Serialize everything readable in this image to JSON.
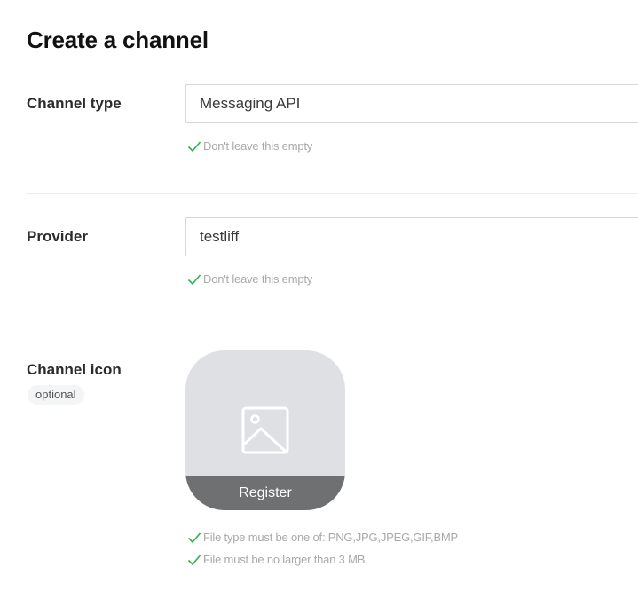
{
  "page": {
    "title": "Create a channel"
  },
  "channel_type": {
    "label": "Channel type",
    "value": "Messaging API",
    "hint": "Don't leave this empty"
  },
  "provider": {
    "label": "Provider",
    "value": "testliff",
    "hint": "Don't leave this empty"
  },
  "channel_icon": {
    "label": "Channel icon",
    "optional_badge": "optional",
    "register_label": "Register",
    "hints": [
      "File type must be one of: PNG,JPG,JPEG,GIF,BMP",
      "File must be no larger than 3 MB"
    ]
  },
  "colors": {
    "check": "#2db24a",
    "placeholder_bg": "#dfe0e4",
    "register_bg": "#6f7072"
  },
  "icons": {
    "check": "check-icon",
    "image": "image-placeholder-icon"
  }
}
